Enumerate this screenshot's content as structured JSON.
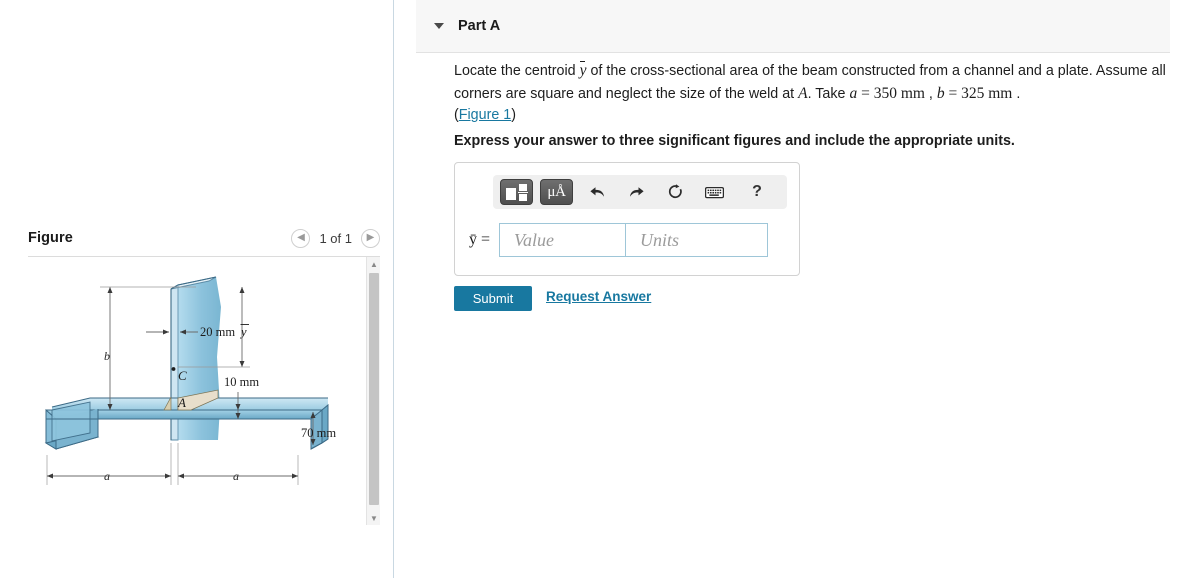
{
  "figure_panel": {
    "title": "Figure",
    "prev_icon": "chevron-left-icon",
    "next_icon": "chevron-right-icon",
    "counter": "1 of 1",
    "diagram": {
      "labels": {
        "dim_web_thickness": "20 mm",
        "centroid_symbol": "ȳ",
        "height_symbol": "b",
        "centroid_point": "C",
        "weld_point": "A",
        "dim_plate_thickness": "10 mm",
        "dim_flange_depth": "70 mm",
        "dim_left_span": "a",
        "dim_right_span": "a"
      },
      "colors": {
        "body_fill": "#8dc2db",
        "body_light": "#b8dcec",
        "body_dark": "#5f9ab8",
        "outline": "#3b6b86",
        "weld_fill": "#e8e0c8"
      }
    }
  },
  "part": {
    "caret_icon": "caret-down-icon",
    "title": "Part A",
    "question_line1_a": "Locate the centroid ",
    "question_ybar": "y",
    "question_line1_b": " of the cross-sectional area of the beam constructed from a channel and a plate.",
    "question_line2_a": "Assume all corners are square and neglect the size of the weld at ",
    "question_symbol_A": "A",
    "question_line2_b": ". Take ",
    "question_symbol_a": "a",
    "question_eq1": " = 350 mm",
    "question_comma": " , ",
    "question_symbol_b": "b",
    "question_eq2": " = 325 mm",
    "question_period": " .",
    "figure_link": "Figure 1",
    "paren_open": "(",
    "paren_close": ")",
    "instruction": "Express your answer to three significant figures and include the appropriate units.",
    "toolbar": {
      "template_button": "template-icon",
      "units_button": "μÅ",
      "undo_icon": "undo-arrow-icon",
      "redo_icon": "redo-arrow-icon",
      "reset_icon": "reset-circular-arrow-icon",
      "keyboard_icon": "keyboard-icon",
      "help_icon": "?"
    },
    "answer": {
      "label": "ȳ =",
      "value_placeholder": "Value",
      "units_placeholder": "Units",
      "value": "",
      "units": ""
    },
    "submit_label": "Submit",
    "request_answer_label": "Request Answer"
  },
  "colors": {
    "accent": "#1878a0",
    "header_bg": "#f7f7f7",
    "input_border": "#9ec6d8"
  }
}
